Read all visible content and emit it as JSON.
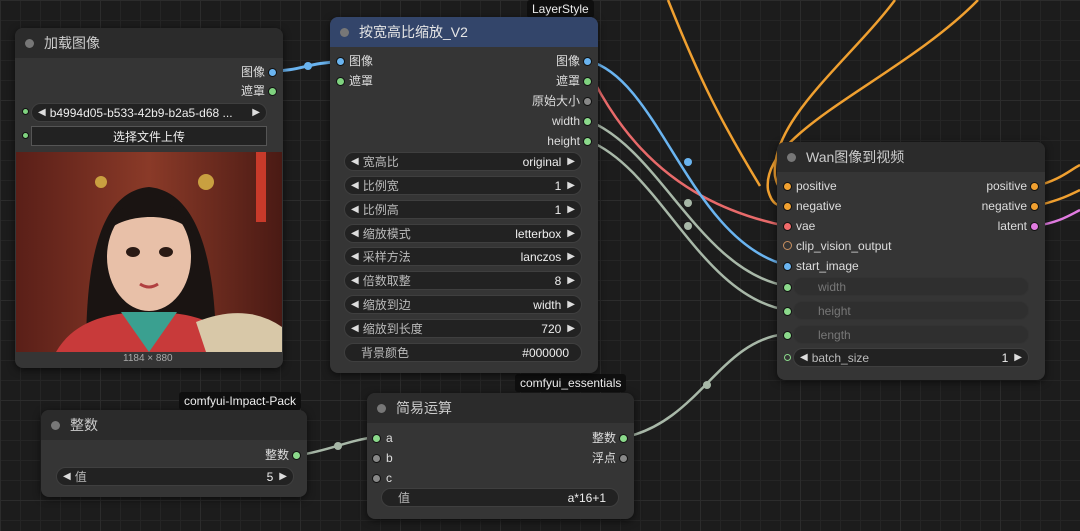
{
  "tags": {
    "layerstyle": "LayerStyle",
    "impact": "comfyui-Impact-Pack",
    "essentials": "comfyui_essentials"
  },
  "load_image": {
    "title": "加载图像",
    "outputs": [
      "图像",
      "遮罩"
    ],
    "file_value": "b4994d05-b533-42b9-b2a5-d68 ...",
    "upload_label": "选择文件上传",
    "image_size": "1184 × 880"
  },
  "resize": {
    "title": "按宽高比缩放_V2",
    "inputs": [
      "图像",
      "遮罩"
    ],
    "outputs": [
      "图像",
      "遮罩",
      "原始大小",
      "width",
      "height"
    ],
    "widgets": [
      {
        "label": "宽高比",
        "value": "original"
      },
      {
        "label": "比例宽",
        "value": "1"
      },
      {
        "label": "比例高",
        "value": "1"
      },
      {
        "label": "缩放模式",
        "value": "letterbox"
      },
      {
        "label": "采样方法",
        "value": "lanczos"
      },
      {
        "label": "倍数取整",
        "value": "8"
      },
      {
        "label": "缩放到边",
        "value": "width"
      },
      {
        "label": "缩放到长度",
        "value": "720"
      },
      {
        "label": "背景颜色",
        "value": "#000000"
      }
    ]
  },
  "wan": {
    "title": "Wan图像到视频",
    "inputs": [
      "positive",
      "negative",
      "vae",
      "clip_vision_output",
      "start_image"
    ],
    "outputs": [
      "positive",
      "negative",
      "latent"
    ],
    "dim_widgets": [
      "width",
      "height",
      "length"
    ],
    "batch": {
      "label": "batch_size",
      "value": "1"
    }
  },
  "integer": {
    "title": "整数",
    "output": "整数",
    "widget": {
      "label": "值",
      "value": "5"
    }
  },
  "math": {
    "title": "简易运算",
    "inputs": [
      "a",
      "b",
      "c"
    ],
    "outputs": [
      "整数",
      "浮点"
    ],
    "widget": {
      "label": "值",
      "value": "a*16+1"
    }
  },
  "colors": {
    "image": "#6ab4f0",
    "mask": "#7fd27f",
    "int": "#8bd98b",
    "cond": "#f0a030",
    "vae": "#f06a6a",
    "latent": "#e07be0",
    "clip": "#c89060"
  }
}
